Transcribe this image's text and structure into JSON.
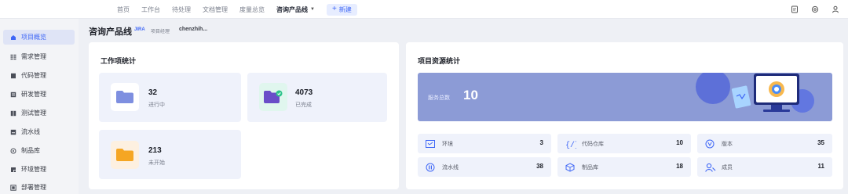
{
  "topnav": {
    "items": [
      "首页",
      "工作台",
      "待处理",
      "文档管理",
      "度量总览"
    ],
    "current_project": "咨询产品线",
    "new_button": "新建"
  },
  "sidebar": {
    "items": [
      {
        "label": "项目概览",
        "icon": "project-overview-icon",
        "active": true
      },
      {
        "label": "需求管理",
        "icon": "requirements-icon"
      },
      {
        "label": "代码管理",
        "icon": "code-icon"
      },
      {
        "label": "研发管理",
        "icon": "dev-icon"
      },
      {
        "label": "测试管理",
        "icon": "test-icon"
      },
      {
        "label": "流水线",
        "icon": "pipeline-icon"
      },
      {
        "label": "制品库",
        "icon": "artifact-icon"
      },
      {
        "label": "环境管理",
        "icon": "environment-icon"
      },
      {
        "label": "部署管理",
        "icon": "deploy-icon"
      }
    ]
  },
  "project": {
    "name": "咨询产品线",
    "tag": "JIRA",
    "type": "项目经理",
    "owner": "chenzhih..."
  },
  "work_stats": {
    "title": "工作项统计",
    "cards": [
      {
        "value": "32",
        "label": "进行中"
      },
      {
        "value": "4073",
        "label": "已完成"
      },
      {
        "value": "213",
        "label": "未开始"
      }
    ]
  },
  "resource_stats": {
    "title": "项目资源统计",
    "total_label": "服务总数",
    "total_value": "10",
    "items": [
      {
        "label": "环境",
        "value": "3",
        "icon": "env-icon"
      },
      {
        "label": "代码仓库",
        "value": "10",
        "icon": "code-repo-icon"
      },
      {
        "label": "版本",
        "value": "35",
        "icon": "version-icon"
      },
      {
        "label": "流水线",
        "value": "38",
        "icon": "pipeline-icon"
      },
      {
        "label": "制品库",
        "value": "18",
        "icon": "artifact-icon"
      },
      {
        "label": "成员",
        "value": "11",
        "icon": "members-icon"
      }
    ]
  },
  "colors": {
    "accent": "#3f67f6",
    "banner": "#8c9bd6",
    "card_bg": "#eff2fb",
    "page_bg": "#eef0f5"
  }
}
